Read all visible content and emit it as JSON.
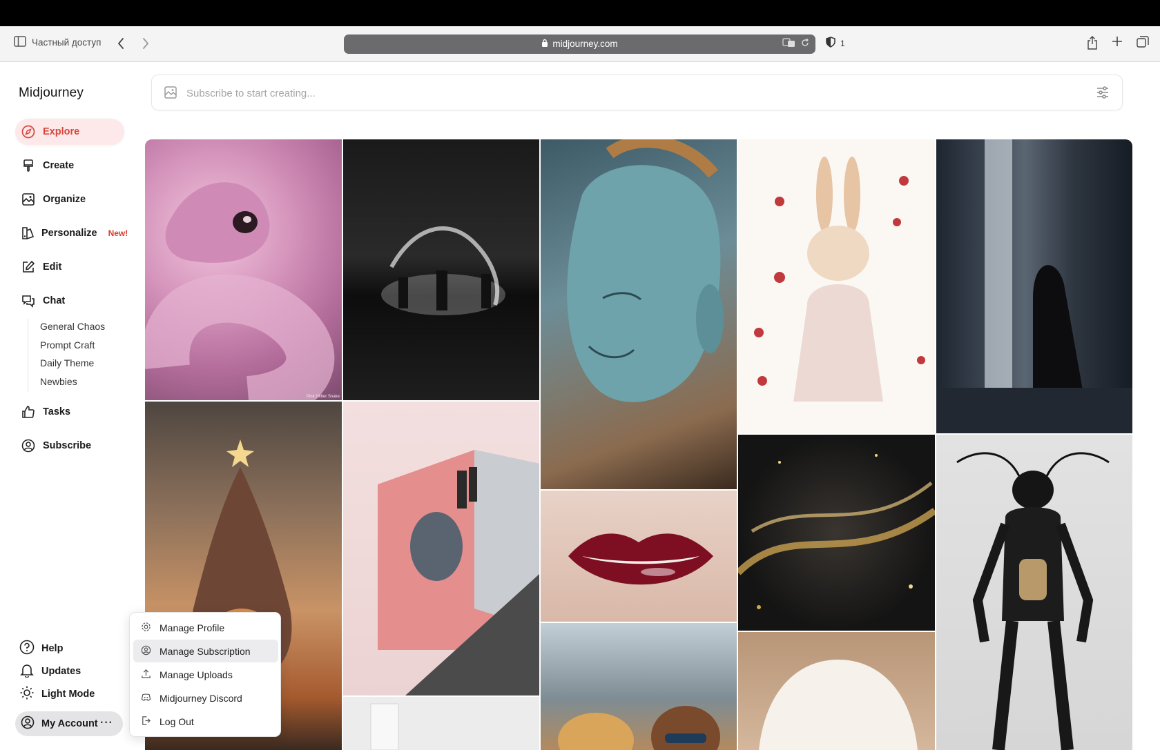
{
  "browser": {
    "sidebar_toggle_label": "Частный доступ",
    "url": "midjourney.com",
    "shield_count": "1"
  },
  "app": {
    "brand": "Midjourney"
  },
  "sidebar": {
    "items": [
      {
        "label": "Explore",
        "icon": "compass-icon"
      },
      {
        "label": "Create",
        "icon": "brush-icon"
      },
      {
        "label": "Organize",
        "icon": "image-icon"
      },
      {
        "label": "Personalize",
        "icon": "personalize-icon",
        "badge": "New!"
      },
      {
        "label": "Edit",
        "icon": "edit-icon"
      },
      {
        "label": "Chat",
        "icon": "chat-icon"
      },
      {
        "label": "Tasks",
        "icon": "thumbs-up-icon"
      },
      {
        "label": "Subscribe",
        "icon": "user-circle-icon"
      }
    ],
    "chat_rooms": [
      "General Chaos",
      "Prompt Craft",
      "Daily Theme",
      "Newbies"
    ],
    "footer": [
      {
        "label": "Help",
        "icon": "help-icon"
      },
      {
        "label": "Updates",
        "icon": "bell-icon"
      },
      {
        "label": "Light Mode",
        "icon": "sun-icon"
      }
    ],
    "account_label": "My Account",
    "account_more": "···"
  },
  "prompt": {
    "placeholder": "Subscribe to start creating..."
  },
  "gallery": {
    "tile_caption": "Pink Glitter Snake"
  },
  "account_menu": {
    "items": [
      {
        "label": "Manage Profile",
        "icon": "gear-icon"
      },
      {
        "label": "Manage Subscription",
        "icon": "user-circle-icon"
      },
      {
        "label": "Manage Uploads",
        "icon": "upload-icon"
      },
      {
        "label": "Midjourney Discord",
        "icon": "discord-icon"
      },
      {
        "label": "Log Out",
        "icon": "logout-icon"
      }
    ],
    "highlighted": "Manage Subscription"
  },
  "colors": {
    "accent": "#d9453c",
    "active_bg": "#fde9e9"
  }
}
